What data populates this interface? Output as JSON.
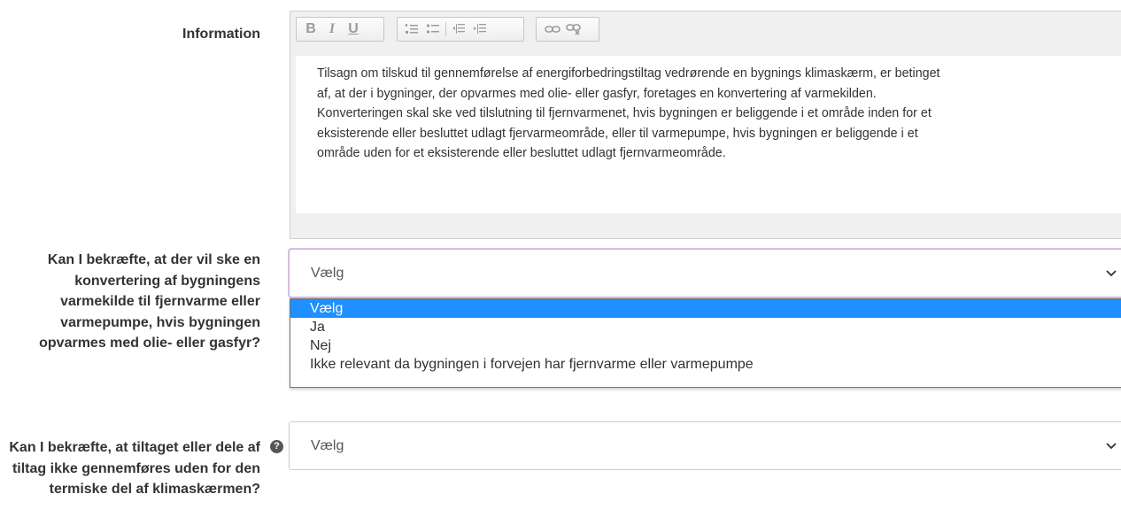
{
  "information": {
    "label": "Information",
    "toolbar": {
      "bold": "B",
      "italic": "I",
      "underline": "U",
      "icons": [
        "bold-icon",
        "italic-icon",
        "underline-icon",
        "numbered-list-icon",
        "bullet-list-icon",
        "outdent-icon",
        "indent-icon",
        "link-icon",
        "unlink-icon"
      ]
    },
    "text_lines": [
      "Tilsagn om tilskud til gennemførelse af energiforbedringstiltag vedrørende en bygnings klimaskærm, er betinget",
      "af, at der i bygninger, der opvarmes med olie- eller gasfyr, foretages en konvertering af varmekilden.",
      "Konverteringen skal ske ved tilslutning til fjernvarmenet, hvis bygningen er beliggende i et område inden for et",
      "eksisterende eller besluttet udlagt fjervarmeområde, eller til varmepumpe, hvis bygningen er beliggende i et",
      "område uden for et eksisterende eller besluttet udlagt fjernvarmeområde."
    ]
  },
  "question1": {
    "label": "Kan I bekræfte, at der vil ske en konvertering af bygningens varmekilde til fjernvarme eller varmepumpe, hvis bygningen opvarmes med olie- eller gasfyr?",
    "selected": "Vælg",
    "options": [
      "Vælg",
      "Ja",
      "Nej",
      "Ikke relevant da bygningen i forvejen har fjernvarme eller varmepumpe"
    ]
  },
  "question2": {
    "label": "Kan I bekræfte, at tiltaget eller dele af tiltag ikke gennemføres uden for den termiske del af klimaskærmen?",
    "help_icon": "?",
    "selected": "Vælg"
  },
  "colors": {
    "highlight": "#1e90ff",
    "focus_border": "#c8b0d8"
  }
}
